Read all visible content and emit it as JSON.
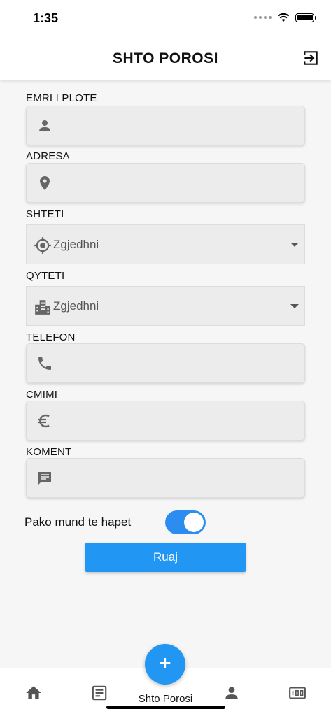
{
  "status_bar": {
    "time": "1:35"
  },
  "header": {
    "title": "SHTO POROSI"
  },
  "form": {
    "full_name": {
      "label": "EMRI I PLOTE",
      "value": "",
      "icon": "person-icon"
    },
    "address": {
      "label": "ADRESA",
      "value": "",
      "icon": "location-pin-icon"
    },
    "country": {
      "label": "SHTETI",
      "selected": "Zgjedhni",
      "icon": "gps-target-icon"
    },
    "city": {
      "label": "QYTETI",
      "selected": "Zgjedhni",
      "icon": "city-building-icon"
    },
    "phone": {
      "label": "TELEFON",
      "value": "",
      "icon": "phone-icon"
    },
    "price": {
      "label": "CMIMI",
      "value": "",
      "icon": "euro-icon"
    },
    "comment": {
      "label": "KOMENT",
      "value": "",
      "icon": "comment-icon"
    },
    "toggle": {
      "label": "Pako mund te hapet",
      "on": true
    },
    "save_label": "Ruaj"
  },
  "bottom_nav": {
    "fab_label": "Shto Porosi",
    "items": [
      "home-icon",
      "document-icon",
      "add-icon",
      "person-icon",
      "counter-icon"
    ]
  },
  "colors": {
    "accent": "#2196f3",
    "toggle": "#2d8cf0",
    "field_bg": "#ececec",
    "icon": "#666666"
  }
}
